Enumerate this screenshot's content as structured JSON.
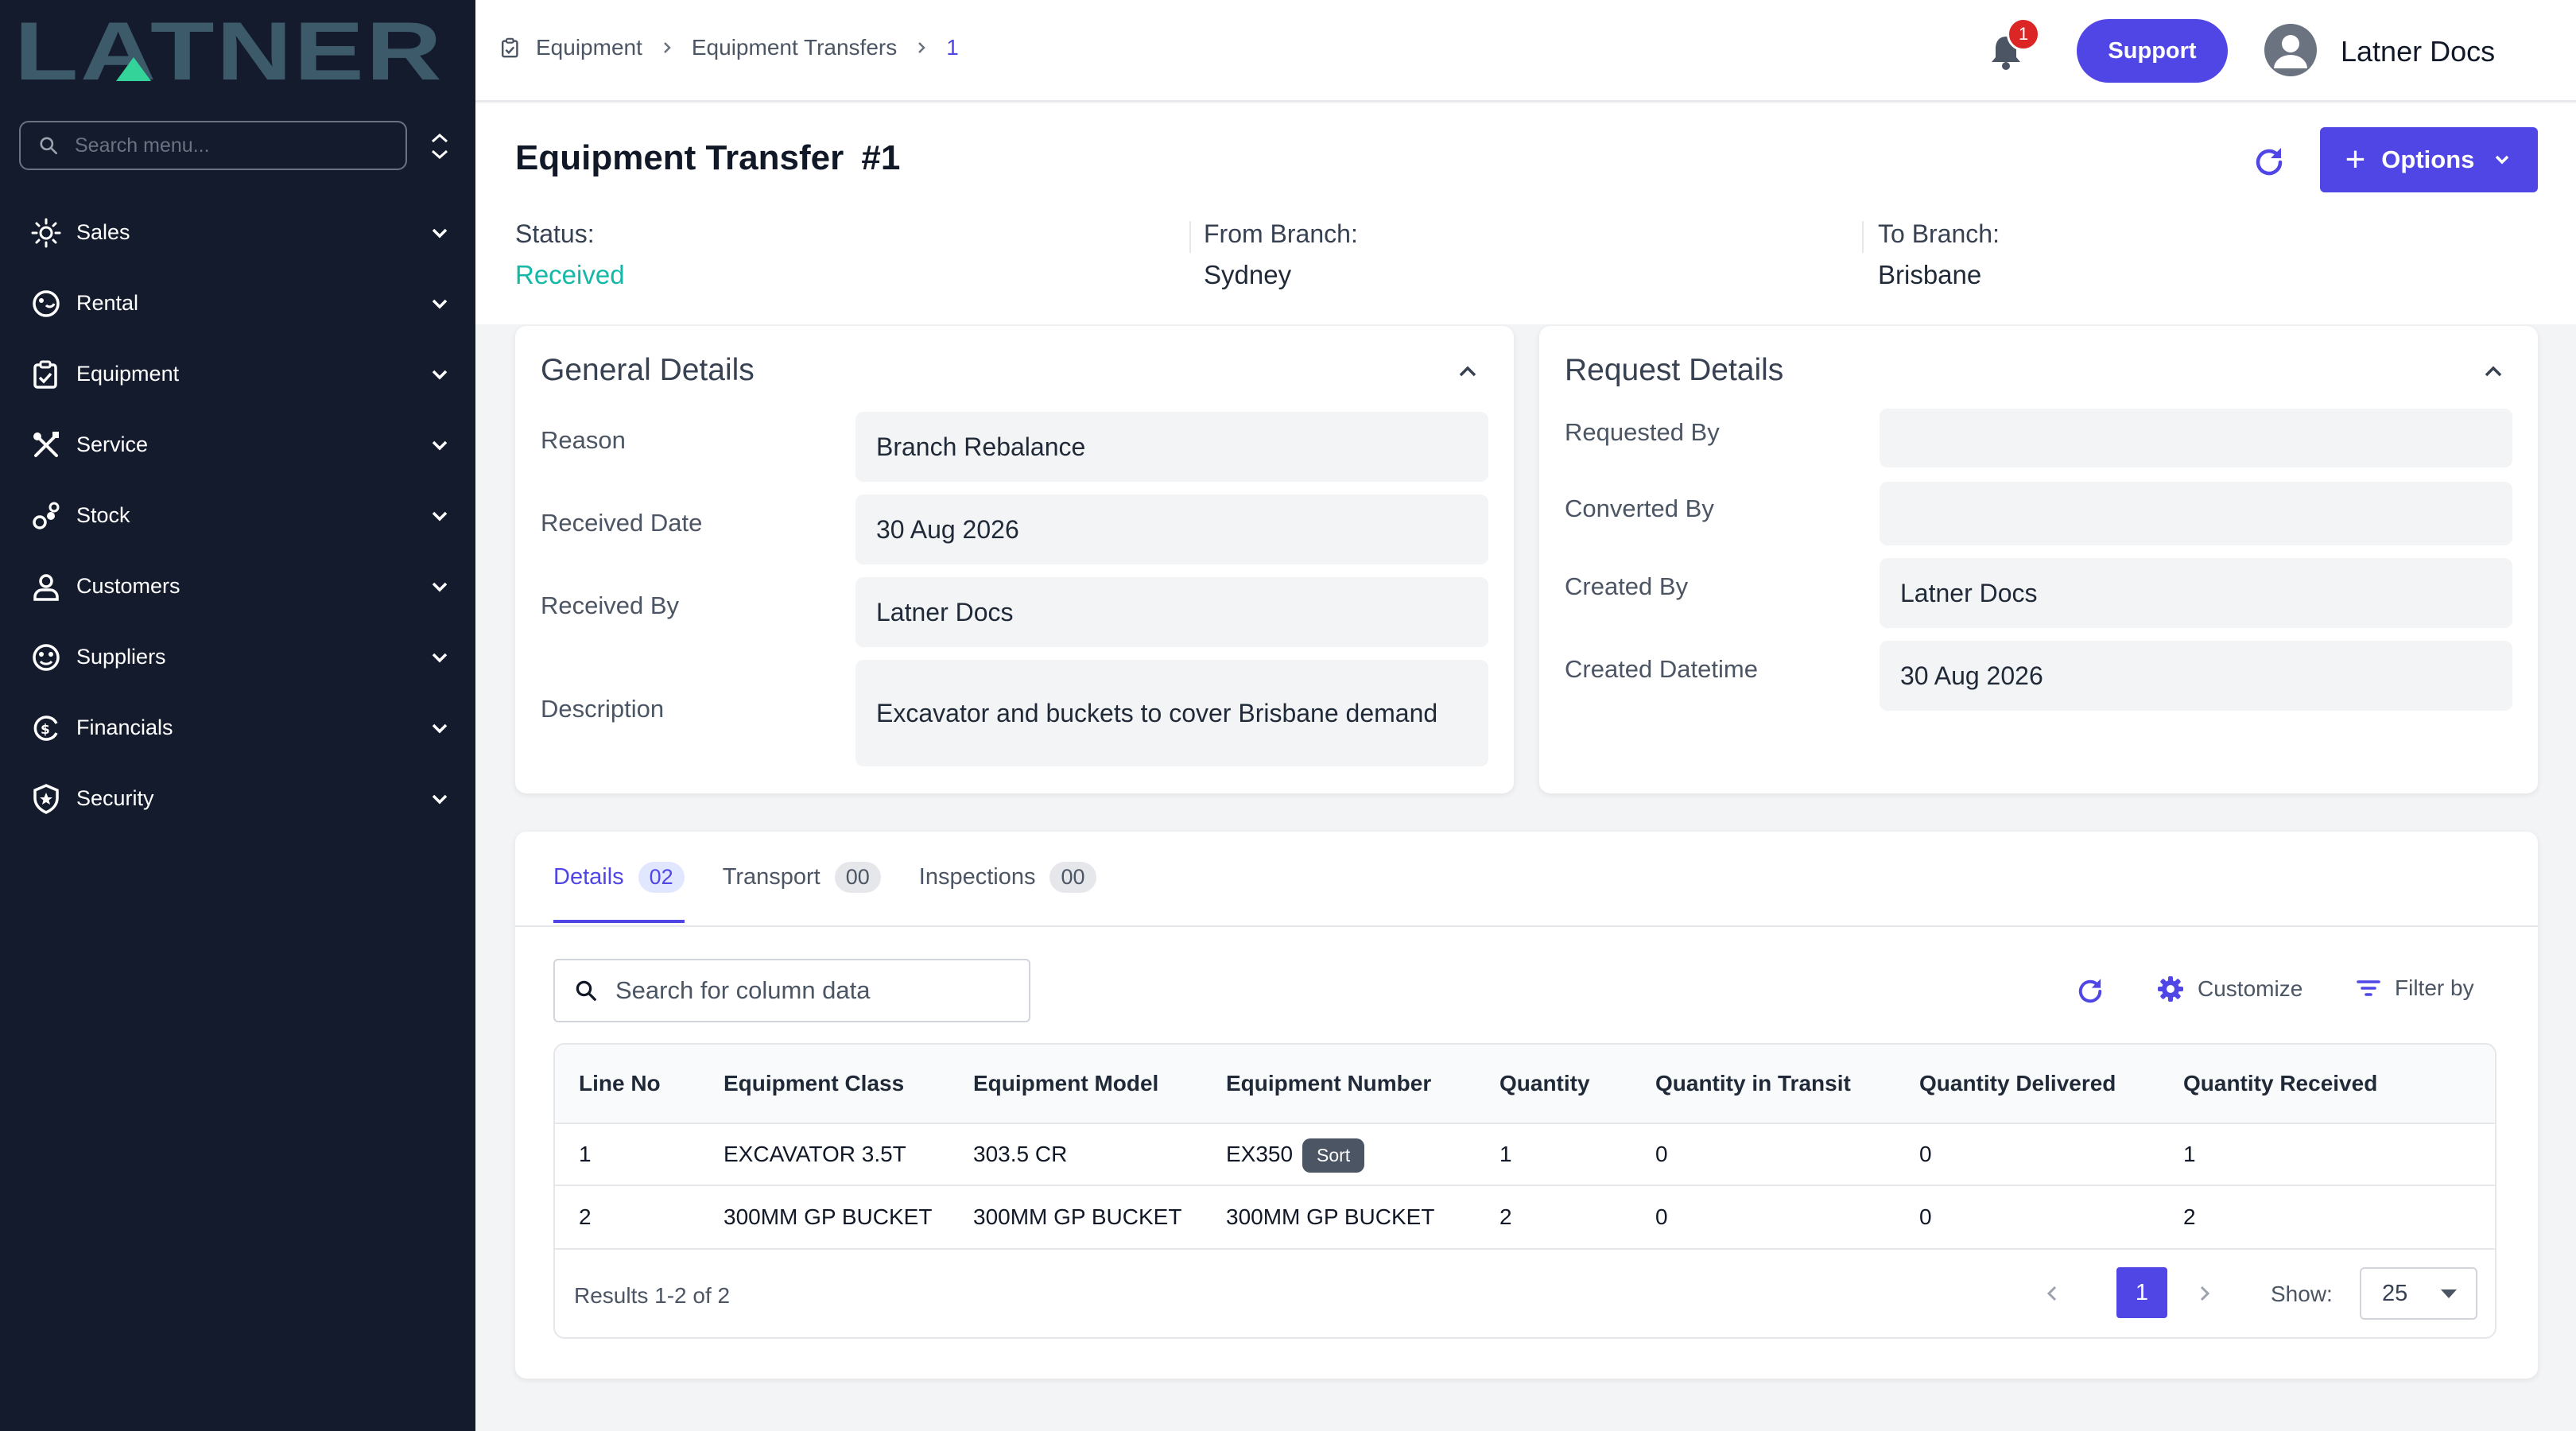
{
  "app": {
    "brand": "LATNER"
  },
  "sidebar": {
    "search_placeholder": "Search menu...",
    "items": [
      {
        "label": "Sales",
        "icon": "sales-icon"
      },
      {
        "label": "Rental",
        "icon": "rental-icon"
      },
      {
        "label": "Equipment",
        "icon": "equipment-icon"
      },
      {
        "label": "Service",
        "icon": "service-icon"
      },
      {
        "label": "Stock",
        "icon": "stock-icon"
      },
      {
        "label": "Customers",
        "icon": "customers-icon"
      },
      {
        "label": "Suppliers",
        "icon": "suppliers-icon"
      },
      {
        "label": "Financials",
        "icon": "financials-icon"
      },
      {
        "label": "Security",
        "icon": "security-icon"
      }
    ]
  },
  "topbar": {
    "breadcrumb": [
      "Equipment",
      "Equipment Transfers",
      "1"
    ],
    "notification_count": "1",
    "support_label": "Support",
    "user_name": "Latner Docs"
  },
  "header": {
    "title": "Equipment Transfer",
    "number": "#1",
    "options_label": "Options",
    "status_label": "Status:",
    "status_value": "Received",
    "from_label": "From Branch:",
    "from_value": "Sydney",
    "to_label": "To Branch:",
    "to_value": "Brisbane"
  },
  "general": {
    "title": "General Details",
    "fields": [
      {
        "label": "Reason",
        "value": "Branch Rebalance"
      },
      {
        "label": "Received Date",
        "value": "30 Aug 2026"
      },
      {
        "label": "Received By",
        "value": "Latner Docs"
      },
      {
        "label": "Description",
        "value": "Excavator and buckets to cover Brisbane demand"
      }
    ]
  },
  "request": {
    "title": "Request Details",
    "fields": [
      {
        "label": "Requested By",
        "value": ""
      },
      {
        "label": "Converted By",
        "value": ""
      },
      {
        "label": "Created By",
        "value": "Latner Docs"
      },
      {
        "label": "Created Datetime",
        "value": "30 Aug 2026"
      }
    ]
  },
  "tabs": [
    {
      "label": "Details",
      "count": "02"
    },
    {
      "label": "Transport",
      "count": "00"
    },
    {
      "label": "Inspections",
      "count": "00"
    }
  ],
  "table": {
    "search_placeholder": "Search for column data",
    "customize_label": "Customize",
    "filter_label": "Filter by",
    "columns": [
      "Line No",
      "Equipment Class",
      "Equipment Model",
      "Equipment Number",
      "Quantity",
      "Quantity in Transit",
      "Quantity Delivered",
      "Quantity Received"
    ],
    "rows": [
      [
        "1",
        "EXCAVATOR 3.5T",
        "303.5 CR",
        "EX350",
        "1",
        "0",
        "0",
        "1"
      ],
      [
        "2",
        "300MM GP BUCKET",
        "300MM GP BUCKET",
        "300MM GP BUCKET",
        "2",
        "0",
        "0",
        "2"
      ]
    ],
    "sort_tooltip": "Sort",
    "results_text": "Results 1-2 of 2",
    "current_page": "1",
    "show_label": "Show:",
    "page_size": "25"
  },
  "colors": {
    "accent": "#4f46e5",
    "sidebar": "#141b2d",
    "status_green": "#14b8a6",
    "badge_red": "#dc2626"
  }
}
